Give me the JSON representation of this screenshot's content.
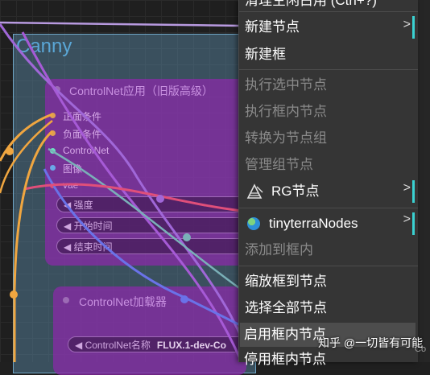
{
  "canvas": {
    "group_title": "Canny",
    "node_apply": {
      "title": "ControlNet应用（旧版高级）",
      "inputs": [
        "正面条件",
        "负面条件",
        "ControlNet",
        "图像",
        "vae"
      ],
      "widgets": [
        "强度",
        "开始时间",
        "结束时间"
      ]
    },
    "node_loader": {
      "title": "ControlNet加载器",
      "widget_label": "ControlNet名称",
      "widget_value": "FLUX.1-dev-Co"
    }
  },
  "menu": {
    "top_partial": "清理空闲占用 (Ctrl+?)",
    "items": [
      {
        "label": "新建节点",
        "enabled": true,
        "submenu": true
      },
      {
        "label": "新建框",
        "enabled": true,
        "submenu": false
      },
      {
        "label": "执行选中节点",
        "enabled": false,
        "submenu": false
      },
      {
        "label": "执行框内节点",
        "enabled": false,
        "submenu": false
      },
      {
        "label": "转换为节点组",
        "enabled": false,
        "submenu": false
      },
      {
        "label": "管理组节点",
        "enabled": false,
        "submenu": false
      },
      {
        "label": "RG节点",
        "enabled": true,
        "submenu": true
      },
      {
        "label": "tinyterraNodes",
        "enabled": true,
        "submenu": true
      },
      {
        "label": "添加到框内",
        "enabled": false,
        "submenu": false
      },
      {
        "label": "缩放框到节点",
        "enabled": true,
        "submenu": false
      },
      {
        "label": "选择全部节点",
        "enabled": true,
        "submenu": false
      },
      {
        "label": "启用框内节点",
        "enabled": true,
        "submenu": false
      },
      {
        "label": "停用框内节点",
        "enabled": true,
        "submenu": false
      }
    ],
    "submenu_arrow": ">"
  },
  "watermark": "知乎 @一切皆有可能",
  "corner_text": "Co",
  "colors": {
    "menu_bg": "#353535",
    "menu_accent": "#3ad1d1",
    "node_purple": "#8c28aa",
    "group_blue": "#5a8caa"
  },
  "icons": {
    "rg": "mountain-ruler-icon",
    "tinyterra": "globe-icon"
  }
}
